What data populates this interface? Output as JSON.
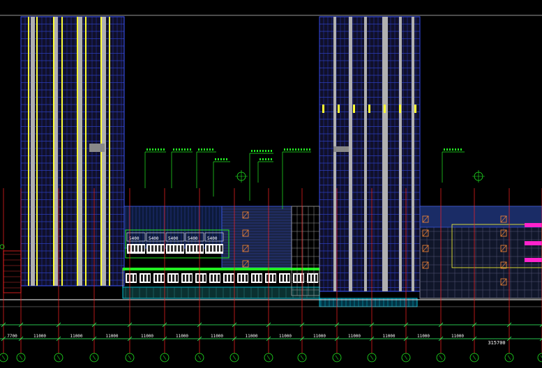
{
  "colors": {
    "background": "#000000",
    "tower_outline": "#3a55ff",
    "tower_fill": "#1a1a3a",
    "column_yellow": "#ffff33",
    "column_grey": "#b0b0b0",
    "grid_red": "#ff2222",
    "leader_green": "#22ee22",
    "facade_blue": "#4060ff",
    "accent_magenta": "#ff22cc",
    "accent_cyan": "#00e5ff",
    "accent_orange": "#ff8a33",
    "dimension_green": "#33ff66",
    "axis_circle": "#22ee22"
  },
  "dimensions": {
    "spans": [
      "7700",
      "11000",
      "11000",
      "11000",
      "11000",
      "11000",
      "11000",
      "11000",
      "11000",
      "11000",
      "11000",
      "11000",
      "11000",
      "11000"
    ],
    "total": "315700"
  },
  "podium_labels": [
    "5400",
    "5400",
    "5400",
    "5400",
    "5400"
  ],
  "icons": [
    "level-symbol-icon",
    "level-symbol-icon",
    "level-symbol-icon"
  ]
}
